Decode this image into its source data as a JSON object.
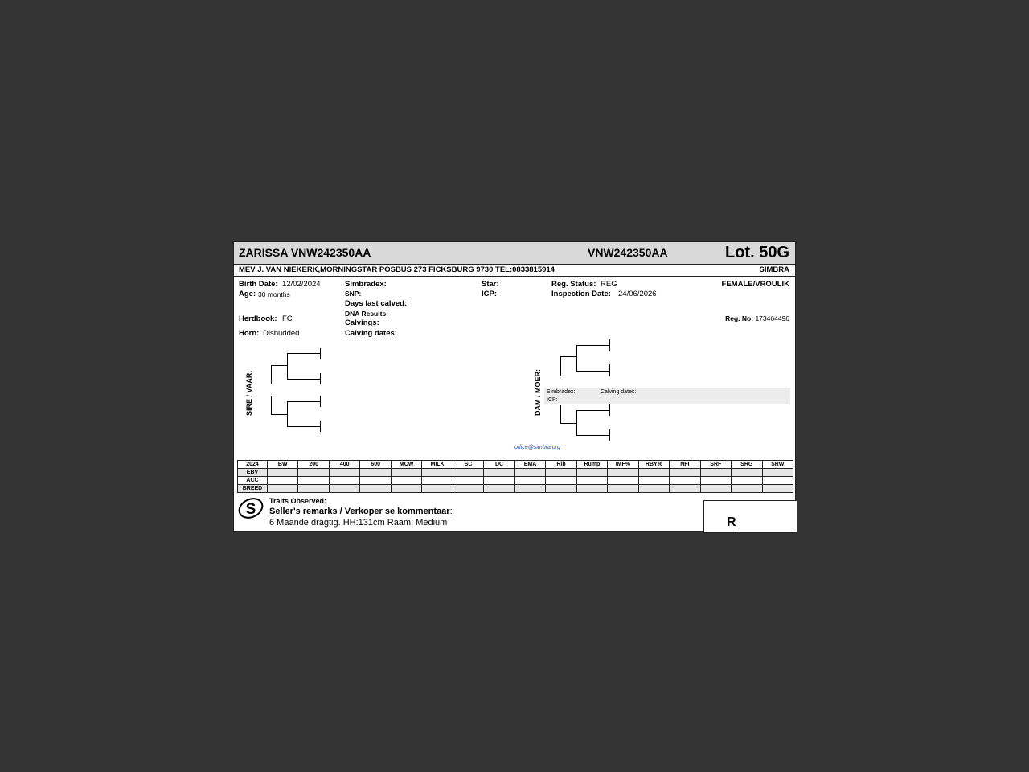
{
  "header": {
    "name": "ZARISSA VNW242350AA",
    "reg_code": "VNW242350AA",
    "lot": "Lot. 50G"
  },
  "owner": {
    "line": "MEV J. VAN NIEKERK,MORNINGSTAR POSBUS 273 FICKSBURG 9730 TEL:0833815914",
    "breed": "SIMBRA"
  },
  "details": {
    "birth_label": "Birth Date:",
    "birth_value": "12/02/2024",
    "age_label": "Age:",
    "age_value": "30 months",
    "herdbook_label": "Herdbook:",
    "herdbook_value": "FC",
    "horn_label": "Horn:",
    "horn_value": "Disbudded",
    "simbradex_label": "Simbradex:",
    "snp_label": "SNP:",
    "days_label": "Days last calved:",
    "dna_label": "DNA Results:",
    "calvings_label": "Calvings:",
    "calving_dates_label": "Calving dates:",
    "star_label": "Star:",
    "icp_label": "ICP:",
    "reg_status_label": "Reg. Status:",
    "reg_status_value": "REG",
    "inspection_label": "Inspection Date:",
    "inspection_value": "24/06/2026",
    "sex": "FEMALE/VROULIK",
    "regno_label": "Reg. No:",
    "regno_value": "173464496"
  },
  "pedigree": {
    "sire_label": "SIRE / VAAR:",
    "dam_label": "DAM / MOER:",
    "dam_simbradex": "Simbradex:",
    "dam_icp": "ICP:",
    "dam_calving_dates": "Calving dates:",
    "email": "office@simbra.org"
  },
  "ebv_table": {
    "headers": [
      "2024",
      "BW",
      "200",
      "400",
      "600",
      "MCW",
      "MILK",
      "SC",
      "DC",
      "EMA",
      "Rib",
      "Rump",
      "IMF%",
      "RBY%",
      "NFI",
      "SRF",
      "SRG",
      "SRW"
    ],
    "rows": [
      "EBV",
      "ACC",
      "BREED"
    ]
  },
  "footer": {
    "logo_letter": "S",
    "traits_label": "Traits Observed:",
    "seller_label": "Seller's remarks / Verkoper se kommentaar",
    "remarks": "6 Maande dragtig. HH:131cm Raam: Medium",
    "price_prefix": "R"
  }
}
